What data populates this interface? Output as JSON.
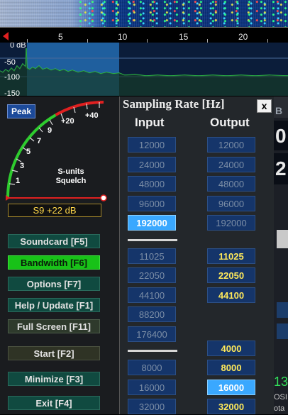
{
  "scale": {
    "ticks": [
      "5",
      "10",
      "15",
      "20"
    ]
  },
  "spectrum": {
    "db_labels": [
      "0 dB",
      "-50",
      "-100",
      "-150"
    ]
  },
  "meter": {
    "peak_label": "Peak",
    "scale_labels": [
      "1",
      "3",
      "5",
      "7",
      "9",
      "+20",
      "+40"
    ],
    "s_units_label": "S-units",
    "squelch_label": "Squelch",
    "readout": "S9 +22 dB"
  },
  "sidebar": {
    "buttons": [
      {
        "label": "Soundcard  [F5]"
      },
      {
        "label": "Bandwidth  [F6]"
      },
      {
        "label": "Options   [F7]"
      },
      {
        "label": "Help / Update  [F1]"
      },
      {
        "label": "Full Screen  [F11]"
      },
      {
        "label": "Start      [F2]"
      },
      {
        "label": "Minimize  [F3]"
      },
      {
        "label": "Exit      [F4]"
      }
    ]
  },
  "sampling_rate": {
    "title": "Sampling Rate [Hz]",
    "close_label": "x",
    "input_header": "Input",
    "output_header": "Output",
    "input_group1": [
      "12000",
      "24000",
      "48000",
      "96000",
      "192000"
    ],
    "output_group1": [
      "12000",
      "24000",
      "48000",
      "96000",
      "192000"
    ],
    "input_group2": [
      "11025",
      "22050",
      "44100",
      "88200",
      "176400"
    ],
    "output_group2": [
      "11025",
      "22050",
      "44100"
    ],
    "input_group3": [
      "8000",
      "16000",
      "32000"
    ],
    "output_group3": [
      "4000",
      "8000",
      "16000",
      "32000"
    ],
    "selected_input": "192000",
    "selected_output": "16000"
  },
  "right_edge": {
    "fragments": [
      "B",
      "0",
      "2",
      "13",
      "OSI",
      "ota"
    ]
  },
  "colors": {
    "accent_selected": "#3aa8ff",
    "active_button": "#18c218",
    "readout_text": "#ffd84a",
    "meter_red": "#e02020",
    "meter_green": "#2ecc2e"
  }
}
